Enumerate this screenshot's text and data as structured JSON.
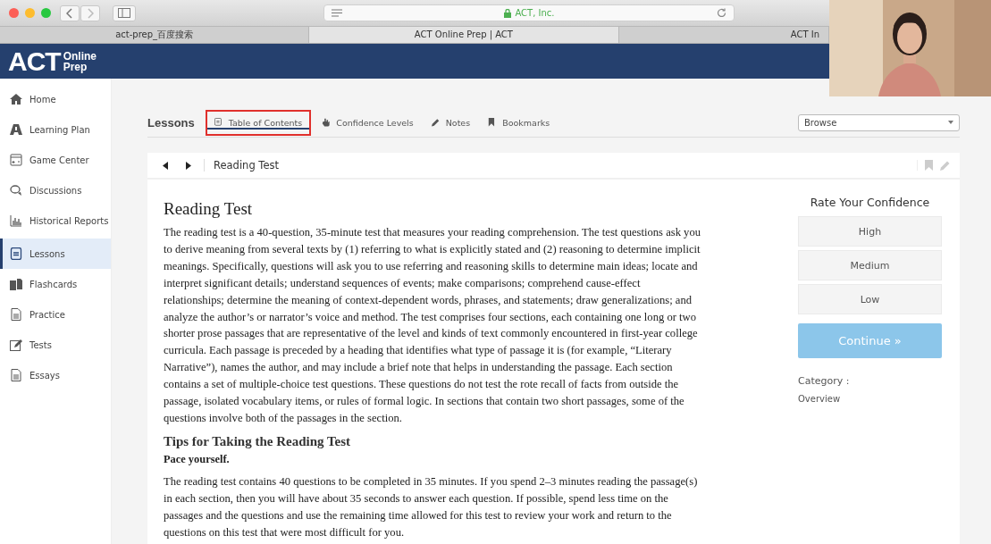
{
  "browser": {
    "address": "ACT, Inc.",
    "tabs": [
      {
        "title": "act-prep_百度搜索",
        "selected": false
      },
      {
        "title": "ACT Online Prep | ACT",
        "selected": true
      },
      {
        "title": "ACT In",
        "selected": false
      }
    ]
  },
  "logo": {
    "mark": "ACT",
    "line_1": "Online",
    "line_2": "Prep"
  },
  "sidebar": {
    "items": [
      {
        "label": "Home",
        "selected": false
      },
      {
        "label": "Learning Plan",
        "selected": false
      },
      {
        "label": "Game Center",
        "selected": false
      },
      {
        "label": "Discussions",
        "selected": false
      },
      {
        "label": "Historical Reports",
        "selected": false
      },
      {
        "label": "Lessons",
        "selected": true
      },
      {
        "label": "Flashcards",
        "selected": false
      },
      {
        "label": "Practice",
        "selected": false
      },
      {
        "label": "Tests",
        "selected": false
      },
      {
        "label": "Essays",
        "selected": false
      }
    ]
  },
  "lessons": {
    "title": "Lessons",
    "tabs": [
      {
        "label": "Table of Contents",
        "selected": true,
        "highlighted": true
      },
      {
        "label": "Confidence Levels",
        "selected": false,
        "highlighted": false
      },
      {
        "label": "Notes",
        "selected": false,
        "highlighted": false
      },
      {
        "label": "Bookmarks",
        "selected": false,
        "highlighted": false
      }
    ],
    "browse": {
      "value": "Browse"
    }
  },
  "lesson": {
    "breadcrumb": "Reading Test",
    "heading": "Reading Test",
    "blocks": [
      {
        "kind": "para",
        "text": "The reading test is a 40-question, 35-minute test that measures your reading comprehension. The test questions ask you to derive meaning from several texts by (1) referring to what is explicitly stated and (2) reasoning to determine implicit meanings. Specifically, questions will ask you to use referring and reasoning skills to determine main ideas; locate and interpret significant details; understand sequences of events; make comparisons; comprehend cause-effect relationships; determine the meaning of context-dependent words, phrases, and statements; draw generalizations; and analyze the author’s or narrator’s voice and method. The test comprises four sections, each containing one long or two shorter prose passages that are representative of the level and kinds of text commonly encountered in first-year college curricula. Each passage is preceded by a heading that identifies what type of passage it is (for example, “Literary Narrative”), names the author, and may include a brief note that helps in understanding the passage. Each section contains a set of multiple-choice test questions. These questions do not test the rote recall of facts from outside the passage, isolated vocabulary items, or rules of formal logic. In sections that contain two short passages, some of the questions involve both of the passages in the section."
      },
      {
        "kind": "subheading",
        "text": "Tips for Taking the Reading Test"
      },
      {
        "kind": "lead",
        "text": "Pace yourself."
      },
      {
        "kind": "para",
        "text": "The reading test contains 40 questions to be completed in 35 minutes. If you spend 2–3 minutes reading the passage(s) in each section, then you will have about 35 seconds to answer each question. If possible, spend less time on the passages and the questions and use the remaining time allowed for this test to review your work and return to the questions on this test that were most difficult for you."
      }
    ]
  },
  "confidence": {
    "title": "Rate Your Confidence",
    "options": [
      {
        "label": "High",
        "selected": false
      },
      {
        "label": "Medium",
        "selected": false
      },
      {
        "label": "Low",
        "selected": false
      }
    ],
    "continue": {
      "label": "Continue »",
      "disabled": true
    },
    "category_label": "Category :",
    "category": "Overview"
  }
}
